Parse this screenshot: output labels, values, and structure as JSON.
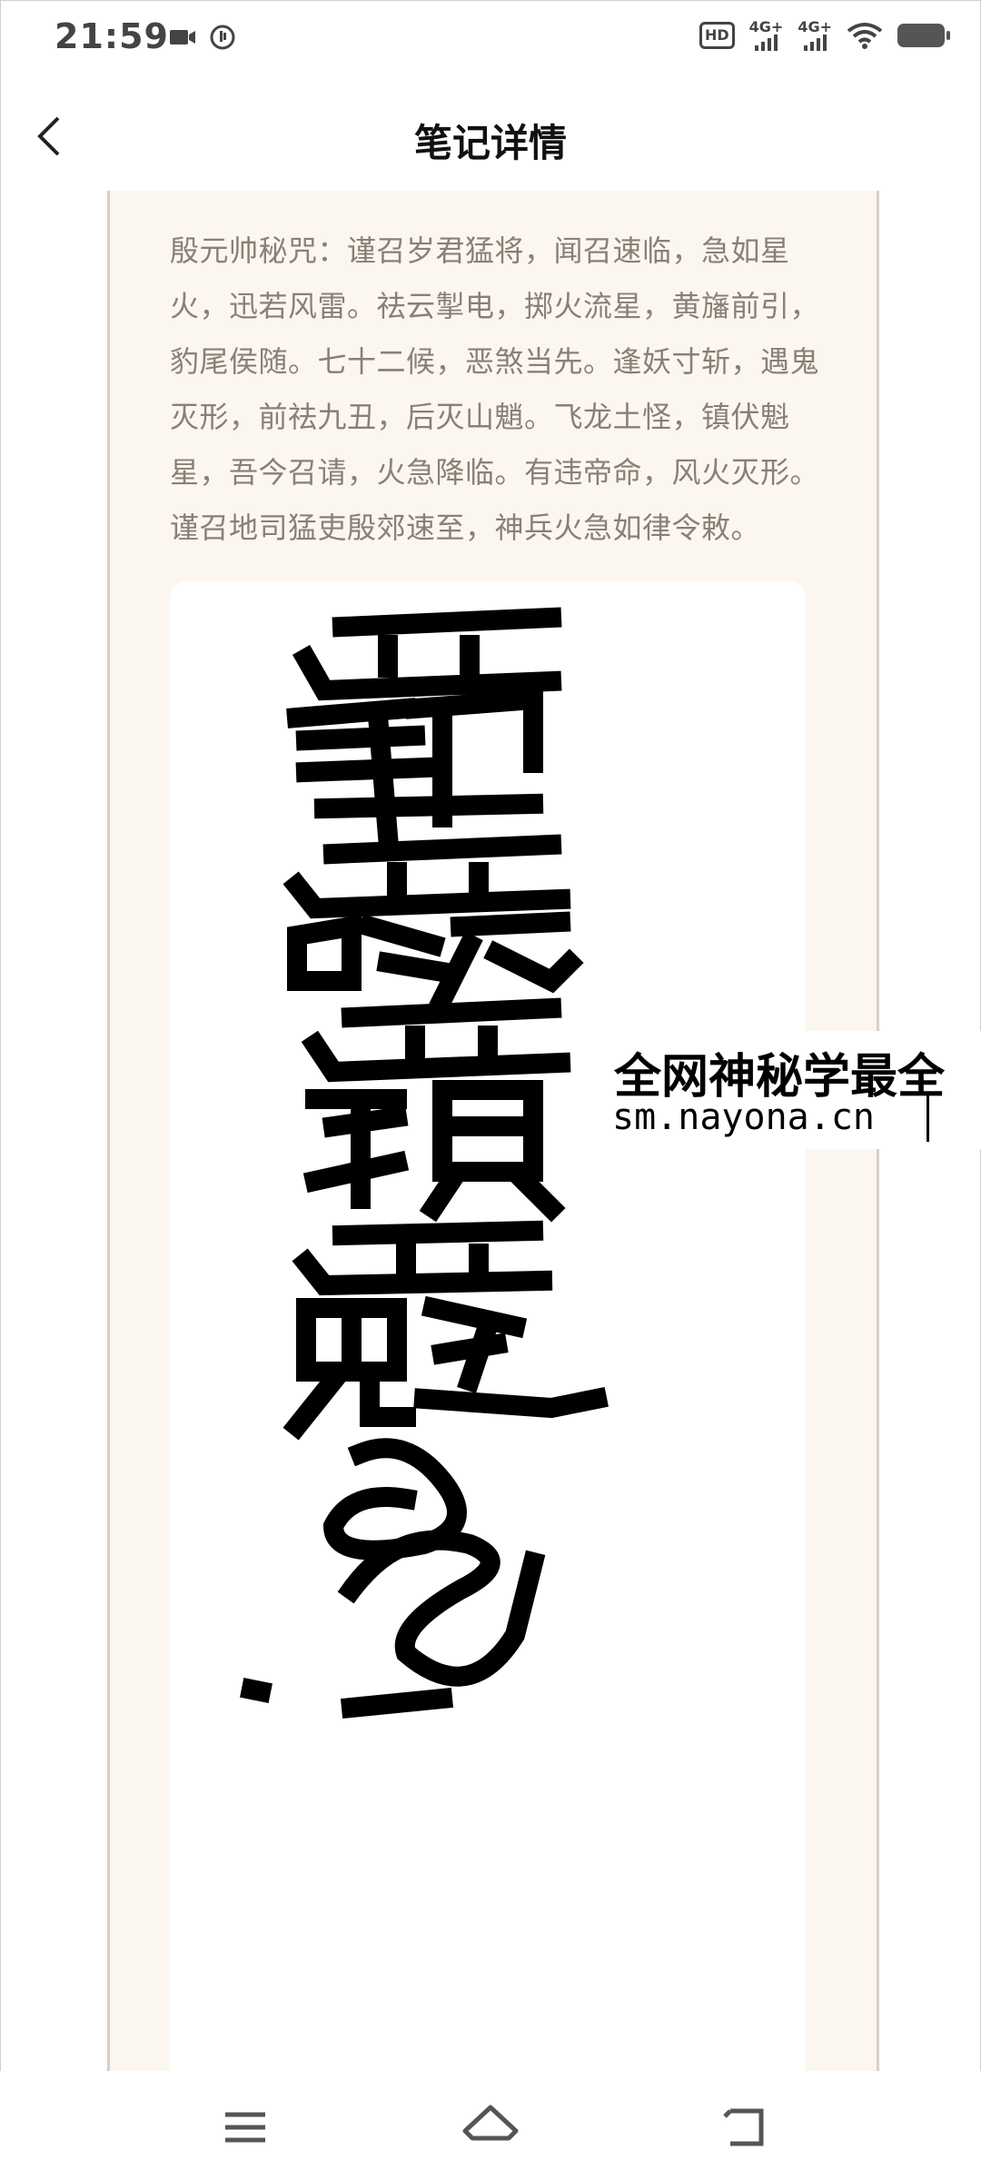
{
  "status_bar": {
    "time": "21:59",
    "left_icons": [
      "video-icon",
      "notification-icon"
    ],
    "hd_label": "HD",
    "network_1": "4G+",
    "network_2": "4G+",
    "right_icons": [
      "wifi-icon",
      "battery-icon"
    ]
  },
  "header": {
    "title": "笔记详情",
    "back_icon": "chevron-left-icon"
  },
  "note": {
    "text": "殷元帅秘咒：谨召岁君猛将，闻召速临，急如星火，迅若风雷。祛云掣电，掷火流星，黄旛前引，豹尾侯随。七十二候，恶煞当先。逢妖寸斩，遇鬼灭形，前祛九丑，后灭山魈。飞龙土怪，镇伏魁星，吾今召请，火急降临。有违帝命，风火灭形。谨召地司猛吏殷郊速至，神兵火急如律令敕。",
    "image": "talisman-calligraphy-image"
  },
  "watermark": {
    "line1": "全网神秘学最全",
    "line2": "sm.nayona.cn"
  },
  "bottom_nav": {
    "items": [
      "menu-icon",
      "home-icon",
      "back-icon"
    ]
  },
  "colors": {
    "panel_bg": "#fbf6ef",
    "text": "#8a7f75",
    "title": "#111111"
  }
}
